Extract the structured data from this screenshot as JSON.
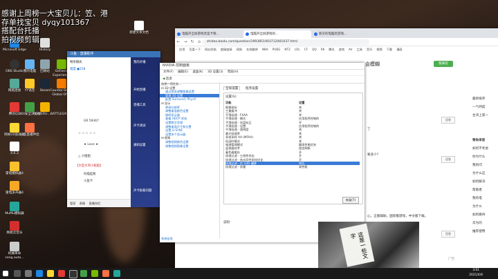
{
  "overlay": {
    "lines": [
      "感谢上周榜一大宝贝儿：笠、港",
      "存单找宝贝 dyqy101367",
      "搭配台托播",
      "拍视频剪辑"
    ]
  },
  "desktop_icons": [
    {
      "label": "Microsoft Edge"
    },
    {
      "label": "History"
    },
    {
      "label": "新建文本文档"
    },
    {
      "label": "OBS Studio"
    },
    {
      "label": "我的电脑"
    },
    {
      "label": "回收站"
    },
    {
      "label": "GeForce Experience"
    },
    {
      "label": "网络连接"
    },
    {
      "label": "YY语音"
    },
    {
      "label": "Steam"
    },
    {
      "label": "Counter-Strike Global Off..."
    },
    {
      "label": "腾讯QQ"
    },
    {
      "label": "360安全浏览器"
    },
    {
      "label": "PLAYERU...BATTLEGR..."
    },
    {
      "label": "网易UU加速器"
    },
    {
      "label": "斗鱼直播伴侣"
    },
    {
      "label": "4.6.3"
    },
    {
      "label": "雷电模拟器4"
    },
    {
      "label": "雷电多开器4"
    },
    {
      "label": "MuMu模拟器"
    },
    {
      "label": "网易云音乐"
    },
    {
      "label": "机械革命 song.auto..."
    }
  ],
  "browser": {
    "tabs": [
      "电脑开全屏游戏老是卡顿...",
      "电脑开全屏游戏的...",
      "新买的电脑玩游戏..."
    ],
    "url": "zhidao.baidu.com/question/1993851903712001037.html",
    "bookmarks": [
      "应用",
      "百度一下",
      "网站导航",
      "超级链接",
      "网易",
      "在线翻译",
      "NBA",
      "PUBG",
      "NTZ",
      "LOL",
      "CF",
      "QQ",
      "R6",
      "腾讯",
      "游戏",
      "AV",
      "工具",
      "音乐",
      "视频",
      "下载",
      "漫画"
    ],
    "heading": "会模糊",
    "answer_button": "我来答",
    "side_lines": [
      "了",
      "要多少?",
      "心，正版辅助，国际服游戏，中文版下载。"
    ],
    "right_lines": [
      "最新排序",
      "一气呵成",
      "台湾上第一",
      "等你来答",
      "如何不考虑",
      "你为什么",
      "我的问",
      "为什么这",
      "如何解决",
      "帮助者",
      "我的电",
      "为什么",
      "如何看待",
      "华为的",
      "推荐使用"
    ],
    "small_buttons": [
      "回答",
      "回答",
      "回答"
    ],
    "footer_right": "广告"
  },
  "chat": {
    "title": "斗鱼 · 直播助手",
    "lines": [
      "畅享模式",
      "程度 ●158",
      "GR 59367",
      "☆ ☆ ☆ ☆ ☆",
      "★ Love ★",
      "△ 小姐姐",
      "【大型大哥小姐姐】",
      "扫描挂粉",
      "斗鱼卡"
    ],
    "bottom": [
      "管家",
      "表情",
      "直播伴侣"
    ],
    "right_lines": [
      "我的开播",
      "开始直播",
      "直播工具",
      "声卡调试",
      "通知设置",
      "声卡板载问题"
    ],
    "right_bottom": "声卡板载问题"
  },
  "nvidia": {
    "title": "NVIDIA 控制面板",
    "menu": [
      "文件(F)",
      "编辑(E)",
      "桌面(K)",
      "3D 设置(3)",
      "帮助(H)"
    ],
    "toolbar": "后退",
    "tree": [
      {
        "text": "选择一项任务...",
        "cls": ""
      },
      {
        "text": "⊟ 3D 设置",
        "cls": ""
      },
      {
        "text": "通过预览调整图像设置",
        "cls": "lnk"
      },
      {
        "text": "管理 3D 设置",
        "cls": "sel"
      },
      {
        "text": "配置 Surround, PhysX",
        "cls": "lnk"
      },
      {
        "text": "⊟ 显示",
        "cls": ""
      },
      {
        "text": "更改分辨率",
        "cls": "lnk"
      },
      {
        "text": "调整桌面颜色设置",
        "cls": "lnk"
      },
      {
        "text": "旋转显示器",
        "cls": "lnk"
      },
      {
        "text": "查看 HDCP 状态",
        "cls": "lnk"
      },
      {
        "text": "设置数字音频",
        "cls": "lnk"
      },
      {
        "text": "调整桌面尺寸和位置",
        "cls": "lnk"
      },
      {
        "text": "设置 G-SYNC",
        "cls": "lnk"
      },
      {
        "text": "设置多个显示器",
        "cls": "lnk"
      },
      {
        "text": "⊟ 视频",
        "cls": ""
      },
      {
        "text": "调整视频颜色设置",
        "cls": "lnk"
      },
      {
        "text": "调整视频图像设置",
        "cls": "lnk"
      }
    ],
    "tabs": [
      "全局设置",
      "程序设置"
    ],
    "grid_head": "设置(S):",
    "col_feature": "功能",
    "col_setting": "设置",
    "rows": [
      {
        "k": "图像锐化",
        "v": "关"
      },
      {
        "k": "三重缓冲",
        "v": "关"
      },
      {
        "k": "平滑处理 - FXAA",
        "v": "关"
      },
      {
        "k": "平滑处理 - 模式",
        "v": "应用程序控制的"
      },
      {
        "k": "平滑处理 - 灰度纠正",
        "v": "开"
      },
      {
        "k": "平滑处理 - 设置",
        "v": "应用程序控制的"
      },
      {
        "k": "平滑处理 - 透明度",
        "v": "关"
      },
      {
        "k": "最大帧速率",
        "v": "关"
      },
      {
        "k": "多帧采样 AA (MFAA)",
        "v": "关"
      },
      {
        "k": "低延时模式",
        "v": "关"
      },
      {
        "k": "电源管理模式",
        "v": "最高性能优先"
      },
      {
        "k": "监视器技术",
        "v": "固定刷新"
      },
      {
        "k": "着色器缓存",
        "v": "开"
      },
      {
        "k": "纹理过滤 - 三线性优化",
        "v": "开"
      },
      {
        "k": "纹理过滤 - 各向异性采样优化",
        "v": "开"
      },
      {
        "k": "纹理过滤 - 负 LOD 偏移",
        "v": "钳位",
        "sel": true
      },
      {
        "k": "纹理过滤 - 质量",
        "v": "高性能"
      }
    ],
    "restore": "恢复(T)",
    "desc": "说明:",
    "sysinfo": "系统信息",
    "apply": "应用(A)"
  },
  "webcam": {
    "paper_text": "这是一些文字"
  },
  "taskbar": {
    "time": "3:01",
    "date": "2021/4/6"
  }
}
